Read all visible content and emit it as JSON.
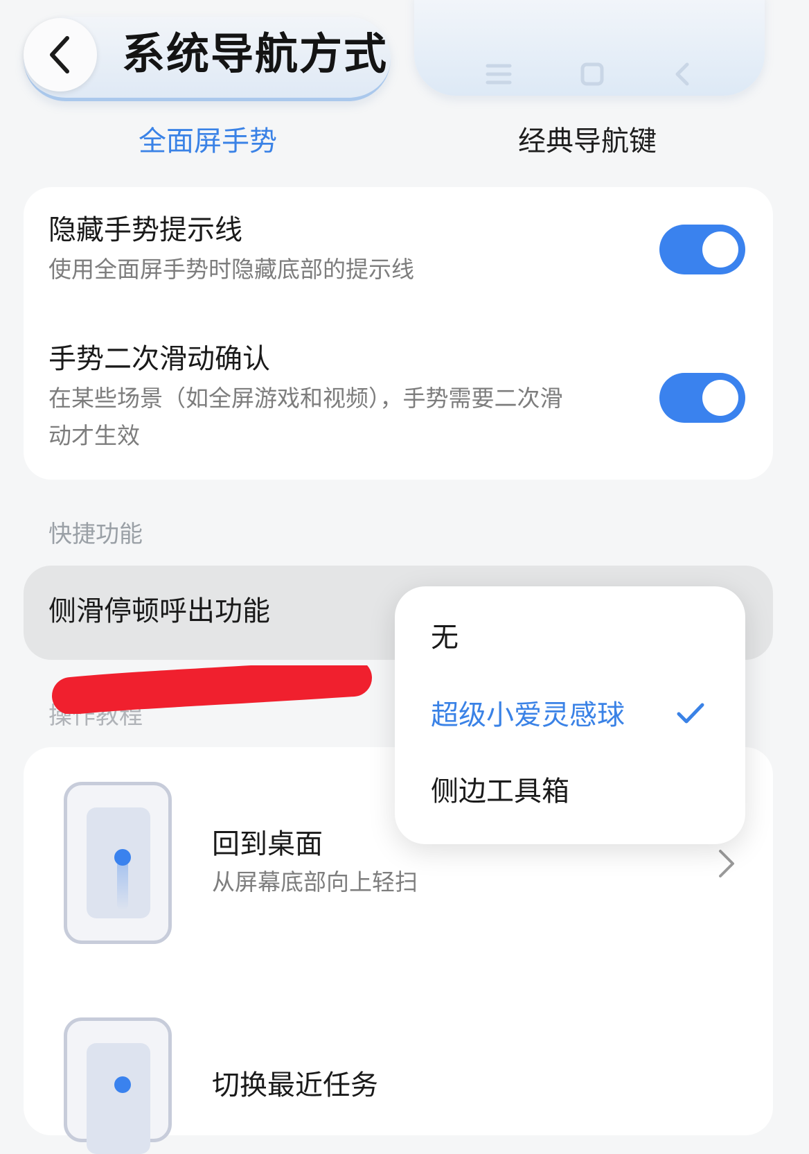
{
  "header": {
    "title": "系统导航方式",
    "back_icon": "chevron-left-icon"
  },
  "tabs": [
    {
      "label": "全面屏手势",
      "active": true
    },
    {
      "label": "经典导航键",
      "active": false
    }
  ],
  "settings": [
    {
      "title": "隐藏手势提示线",
      "description": "使用全面屏手势时隐藏底部的提示线",
      "enabled": true
    },
    {
      "title": "手势二次滑动确认",
      "description_line1": "在某些场景（如全屏游戏和视频），手势需要二次滑",
      "description_line2": "动才生效",
      "enabled": true
    }
  ],
  "shortcut_section": {
    "label": "快捷功能",
    "row_label": "侧滑停顿呼出功能"
  },
  "dropdown": {
    "options": [
      "无",
      "超级小爱灵感球",
      "侧边工具箱"
    ],
    "selected": "超级小爱灵感球"
  },
  "gestures": {
    "section_label": "操作教程",
    "items": [
      {
        "title": "回到桌面",
        "description": "从屏幕底部向上轻扫"
      },
      {
        "title": "切换最近任务"
      }
    ]
  },
  "colors": {
    "accent": "#3a82e6",
    "toggle_on": "#3a82ee",
    "redaction": "#f0202e"
  }
}
